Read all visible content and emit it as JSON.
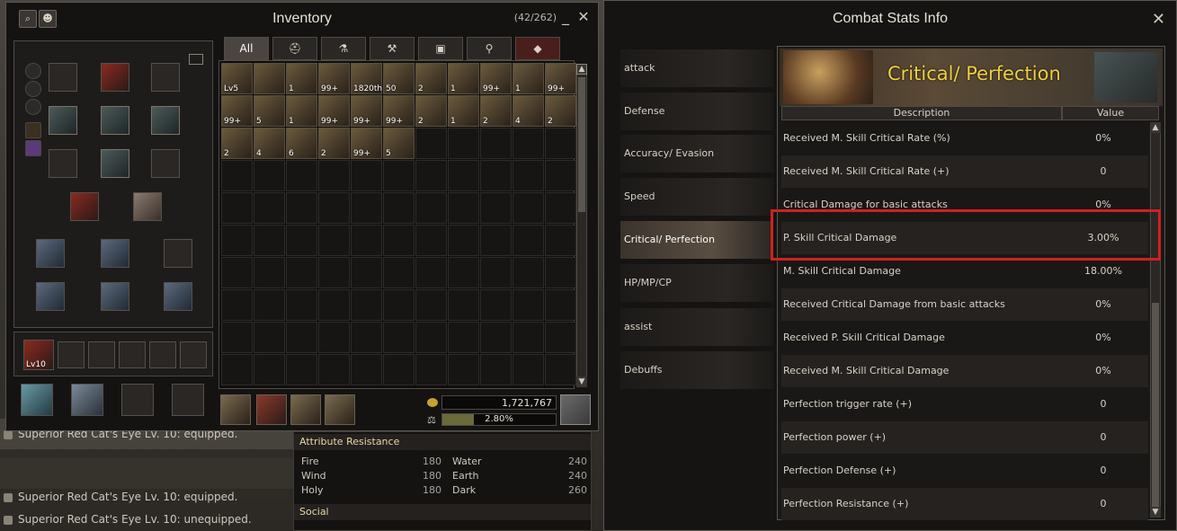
{
  "background_chat": {
    "lines": [
      {
        "text": "Superior Red Cat's Eye Lv. 10: equipped."
      },
      {
        "text": "Superior Red Cat's Eye Lv. 10: equipped."
      },
      {
        "text": "Superior Red Cat's Eye Lv. 10: unequipped."
      }
    ]
  },
  "inventory": {
    "title": "Inventory",
    "count": "(42/262)",
    "minimize": "_",
    "close": "✕",
    "tabs": [
      {
        "label": "All"
      },
      {
        "label": "⛑"
      },
      {
        "label": "⚗"
      },
      {
        "label": "⚒"
      },
      {
        "label": "▣"
      },
      {
        "label": "⚲"
      },
      {
        "label": "◆"
      }
    ],
    "items": [
      {
        "qty": "Lv5"
      },
      {
        "qty": ""
      },
      {
        "qty": "1"
      },
      {
        "qty": "99+"
      },
      {
        "qty": "1820th"
      },
      {
        "qty": "50"
      },
      {
        "qty": "2"
      },
      {
        "qty": "1"
      },
      {
        "qty": "99+"
      },
      {
        "qty": "1"
      },
      {
        "qty": "99+"
      },
      {
        "qty": "99+"
      },
      {
        "qty": "5"
      },
      {
        "qty": "1"
      },
      {
        "qty": "99+"
      },
      {
        "qty": "99+"
      },
      {
        "qty": "99+"
      },
      {
        "qty": "2"
      },
      {
        "qty": "1"
      },
      {
        "qty": "2"
      },
      {
        "qty": "4"
      },
      {
        "qty": "2"
      },
      {
        "qty": "2"
      },
      {
        "qty": "4"
      },
      {
        "qty": "6"
      },
      {
        "qty": "2"
      },
      {
        "qty": "99+"
      },
      {
        "qty": "5"
      }
    ],
    "adena": "1,721,767",
    "weight": "2.80%",
    "weight_fraction": 0.028,
    "quick_item_level": "Lv10"
  },
  "attribute_resistance": {
    "title": "Attribute Resistance",
    "rows": [
      {
        "name": "Fire",
        "value": "180",
        "name2": "Water",
        "value2": "240"
      },
      {
        "name": "Wind",
        "value": "180",
        "name2": "Earth",
        "value2": "240"
      },
      {
        "name": "Holy",
        "value": "180",
        "name2": "Dark",
        "value2": "260"
      }
    ],
    "social_title": "Social"
  },
  "combat_stats": {
    "title": "Combat Stats Info",
    "close": "✕",
    "categories": [
      {
        "label": "attack"
      },
      {
        "label": "Defense"
      },
      {
        "label": "Accuracy/ Evasion"
      },
      {
        "label": "Speed"
      },
      {
        "label": "Critical/ Perfection"
      },
      {
        "label": "HP/MP/CP"
      },
      {
        "label": "assist"
      },
      {
        "label": "Debuffs"
      }
    ],
    "selected_category": "Critical/ Perfection",
    "banner_title": "Critical/ Perfection",
    "columns": {
      "description": "Description",
      "value": "Value"
    },
    "rows": [
      {
        "label": "Received M. Skill Critical Rate (%)",
        "value": "0%"
      },
      {
        "label": "Received M. Skill Critical Rate (+)",
        "value": "0"
      },
      {
        "label": "Critical Damage for basic attacks",
        "value": "0%"
      },
      {
        "label": "P. Skill Critical Damage",
        "value": "3.00%"
      },
      {
        "label": "M. Skill Critical Damage",
        "value": "18.00%"
      },
      {
        "label": "Received Critical Damage from basic attacks",
        "value": "0%"
      },
      {
        "label": "Received P. Skill Critical Damage",
        "value": "0%"
      },
      {
        "label": "Received M. Skill Critical Damage",
        "value": "0%"
      },
      {
        "label": "Perfection trigger rate (+)",
        "value": "0"
      },
      {
        "label": "Perfection power (+)",
        "value": "0"
      },
      {
        "label": "Perfection Defense (+)",
        "value": "0"
      },
      {
        "label": "Perfection Resistance (+)",
        "value": "0"
      }
    ],
    "highlight_color": "#d02020"
  }
}
